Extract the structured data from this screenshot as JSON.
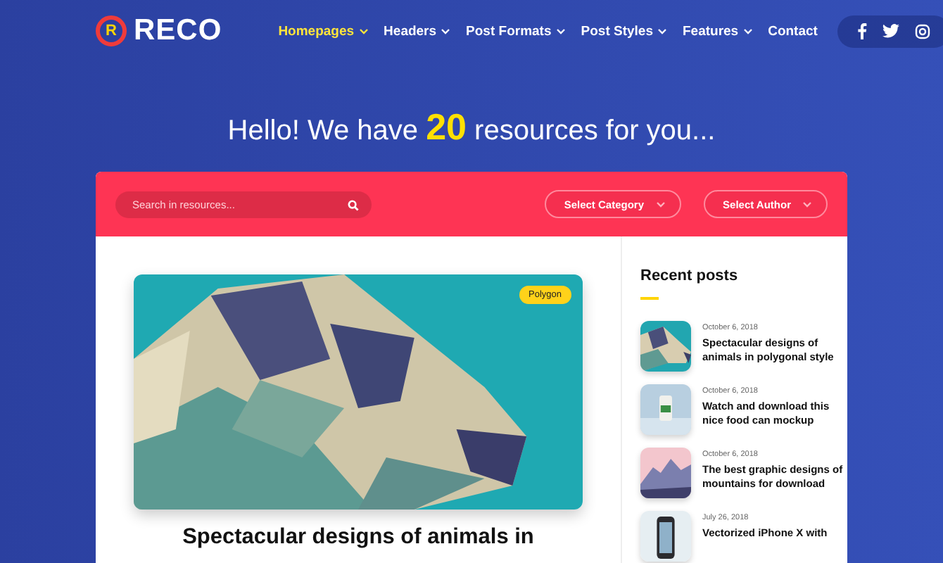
{
  "logo": {
    "mark": "R",
    "name": "RECO"
  },
  "nav": [
    {
      "label": "Homepages",
      "kind": "dropdown",
      "selected": true
    },
    {
      "label": "Headers",
      "kind": "dropdown",
      "selected": false
    },
    {
      "label": "Post Formats",
      "kind": "dropdown",
      "selected": false
    },
    {
      "label": "Post Styles",
      "kind": "dropdown",
      "selected": false
    },
    {
      "label": "Features",
      "kind": "dropdown",
      "selected": false
    },
    {
      "label": "Contact",
      "kind": "link",
      "selected": false
    }
  ],
  "social": [
    {
      "kind": "facebook"
    },
    {
      "kind": "twitter"
    },
    {
      "kind": "instagram"
    }
  ],
  "headline": "Hello! We have **20** resources for you...",
  "search": {
    "placeholder": "Search in resources..."
  },
  "filters": [
    "Select Category",
    "Select Author"
  ],
  "featured": {
    "tag": "Polygon",
    "title": "Spectacular designs of animals in"
  },
  "sidebar": {
    "title": "Recent posts",
    "posts": [
      {
        "date": "October 6, 2018",
        "title": "Spectacular designs of animals in polygonal style"
      },
      {
        "date": "October 6, 2018",
        "title": "Watch and download this nice food can mockup"
      },
      {
        "date": "October 6, 2018",
        "title": "The best graphic designs of mountains for download"
      },
      {
        "date": "July 26, 2018",
        "title": "Vectorized iPhone X with"
      }
    ]
  }
}
